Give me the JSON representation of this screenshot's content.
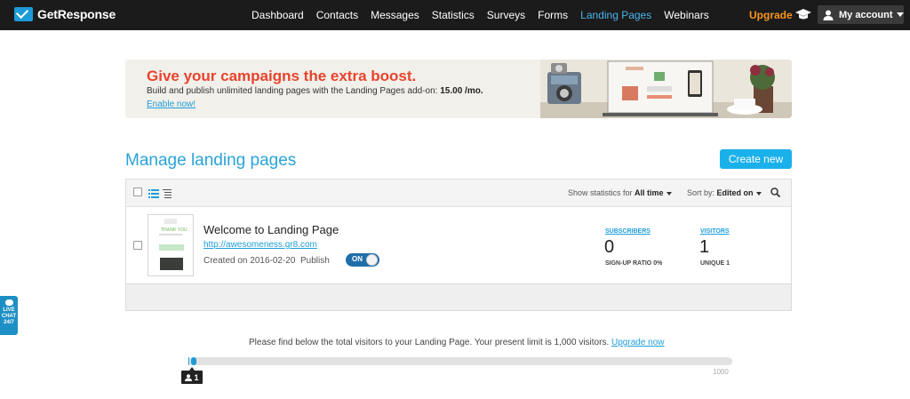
{
  "brand": {
    "name": "GetResponse",
    "accent": "#1d9bd8"
  },
  "nav": {
    "items": [
      "Dashboard",
      "Contacts",
      "Messages",
      "Statistics",
      "Surveys",
      "Forms",
      "Landing Pages",
      "Webinars"
    ],
    "active": "Landing Pages",
    "upgrade": "Upgrade",
    "account": "My account"
  },
  "banner": {
    "title": "Give your campaigns the extra boost.",
    "desc_prefix": "Build and publish unlimited landing pages with the Landing Pages add-on: ",
    "price": "15.00 /mo.",
    "link": "Enable now!"
  },
  "main": {
    "heading": "Manage landing pages",
    "create_button": "Create new"
  },
  "toolbar": {
    "stats_label": "Show statistics for",
    "stats_value": "All time",
    "sort_label": "Sort by:",
    "sort_value": "Edited on"
  },
  "pages": [
    {
      "title": "Welcome to Landing Page",
      "url": "http://awesomeness.gr8.com",
      "created": "Created on 2016-02-20",
      "publish_label": "Publish",
      "toggle": "ON",
      "thumb_text": "THANK YOU",
      "subscribers_label": "SUBSCRIBERS",
      "subscribers": "0",
      "signup_ratio": "SIGN-UP RATIO 0%",
      "visitors_label": "VISITORS",
      "visitors": "1",
      "unique": "UNIQUE 1"
    }
  ],
  "livechat": {
    "line1": "LIVE",
    "line2": "CHAT",
    "line3": "24/7"
  },
  "visitors_limit": {
    "text": "Please find below the total visitors to your Landing Page. Your present limit is 1,000 visitors.",
    "link": "Upgrade now",
    "current": "1",
    "max": "1000",
    "fraction": 0.001
  }
}
